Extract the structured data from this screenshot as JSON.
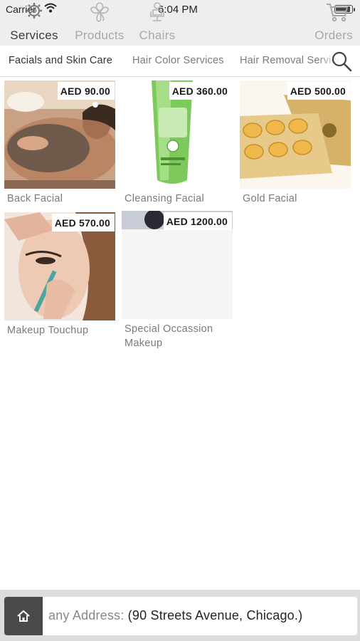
{
  "status_bar": {
    "carrier": "Carrier",
    "time": "6:04 PM"
  },
  "tabs": [
    {
      "label": "Services",
      "icon": "gear-icon",
      "active": true
    },
    {
      "label": "Products",
      "icon": "flower-icon",
      "active": false
    },
    {
      "label": "Chairs",
      "icon": "salon-chair-icon",
      "active": false
    },
    {
      "label": "Orders",
      "icon": "cart-icon",
      "active": false
    }
  ],
  "categories": [
    {
      "label": "Facials and Skin Care",
      "active": true
    },
    {
      "label": "Hair Color Services",
      "active": false
    },
    {
      "label": "Hair Removal Services",
      "active": false
    }
  ],
  "services": [
    {
      "title": "Back Facial",
      "price": "AED 90.00"
    },
    {
      "title": "Cleansing Facial",
      "price": "AED 360.00"
    },
    {
      "title": "Gold Facial",
      "price": "AED 500.00"
    },
    {
      "title": "Makeup Touchup",
      "price": "AED 570.00"
    },
    {
      "title": "Special Occassion Makeup",
      "price": "AED 1200.00"
    }
  ],
  "address_bar": {
    "prefix": "any Address: ",
    "value": "(90 Streets Avenue, Chicago.)"
  },
  "colors": {
    "topbar_bg": "#eeeeee",
    "bottom_bg": "#dddddd",
    "home_btn_bg": "#4a4a4a"
  }
}
